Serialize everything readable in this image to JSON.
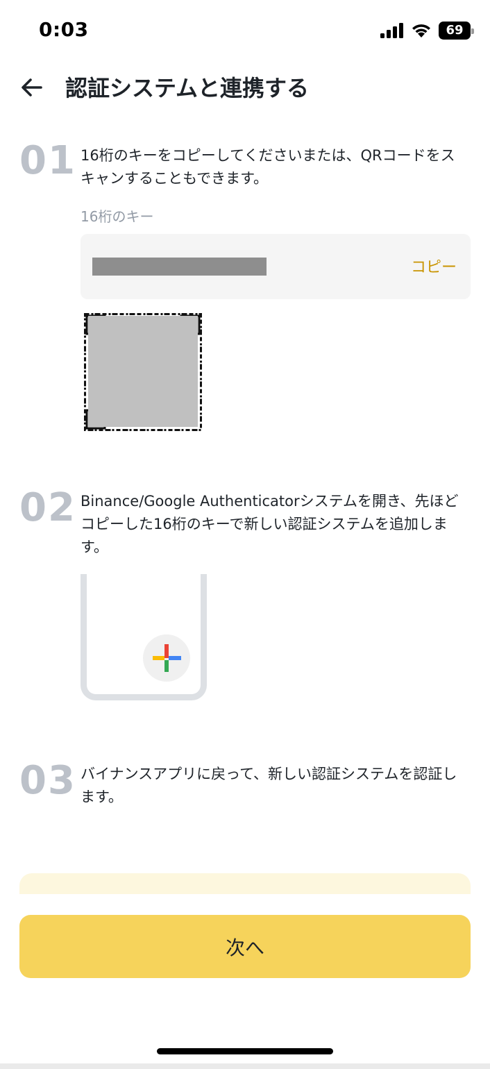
{
  "status_bar": {
    "time": "0:03",
    "battery": "69",
    "icons": [
      "signal-icon",
      "wifi-icon",
      "battery-icon"
    ]
  },
  "header": {
    "title": "認証システムと連携する",
    "back_icon": "arrow-left-icon"
  },
  "steps": [
    {
      "number": "01",
      "text": "16桁のキーをコピーしてくださいまたは、QRコードをスキャンすることもできます。",
      "key_label": "16桁のキー",
      "copy_label": "コピー"
    },
    {
      "number": "02",
      "text": "Binance/Google Authenticatorシステムを開き、先ほどコピーした16桁のキーで新しい認証システムを追加します。"
    },
    {
      "number": "03",
      "text": "バイナンスアプリに戻って、新しい認証システムを認証します。"
    }
  ],
  "footer": {
    "next_label": "次へ"
  },
  "colors": {
    "accent": "#f6d35b",
    "copy_link": "#c99400",
    "step_number": "#bcc1c9",
    "plus_red": "#ea4335",
    "plus_blue": "#4285f4",
    "plus_green": "#34a853",
    "plus_yellow": "#fbbc05"
  }
}
